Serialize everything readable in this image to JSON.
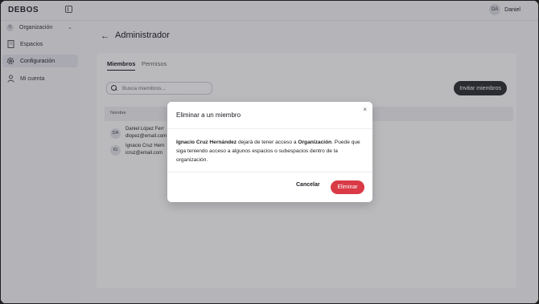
{
  "app": {
    "logo": "DEBOS"
  },
  "user": {
    "initials": "DA",
    "name": "Daniel"
  },
  "sidebar": {
    "items": [
      {
        "label": "Organización",
        "icon": "O"
      },
      {
        "label": "Espacios",
        "icon": "building-icon"
      },
      {
        "label": "Configuración",
        "icon": "gear-icon"
      },
      {
        "label": "Mi cuenta",
        "icon": "person-icon"
      }
    ]
  },
  "page": {
    "title": "Administrador"
  },
  "tabs": [
    {
      "label": "Miembros"
    },
    {
      "label": "Permisos"
    }
  ],
  "search": {
    "placeholder": "Busca miembros..."
  },
  "invite_label": "Invitar miembros",
  "table": {
    "header": "Nombre",
    "rows": [
      {
        "initials": "DA",
        "name": "Daniel López Ferr",
        "email": "dlopez@email.com"
      },
      {
        "initials": "IG",
        "name": "Ignacio Cruz Hern",
        "email": "icruz@email.com"
      }
    ]
  },
  "modal": {
    "title": "Eliminar a un miembro",
    "member_name": "Ignacio Cruz Hernández",
    "text_mid": " dejará de tener acceso a ",
    "org_name": "Organización",
    "text_end": ". Puede que siga teniendo acceso a algunos espacios o subespacios dentro de la organización.",
    "cancel_label": "Cancelar",
    "delete_label": "Eliminar",
    "close_symbol": "×"
  },
  "colors": {
    "danger": "#d93a45",
    "dark_button": "#2d2d33",
    "active_nav": "#e6e6ef"
  }
}
